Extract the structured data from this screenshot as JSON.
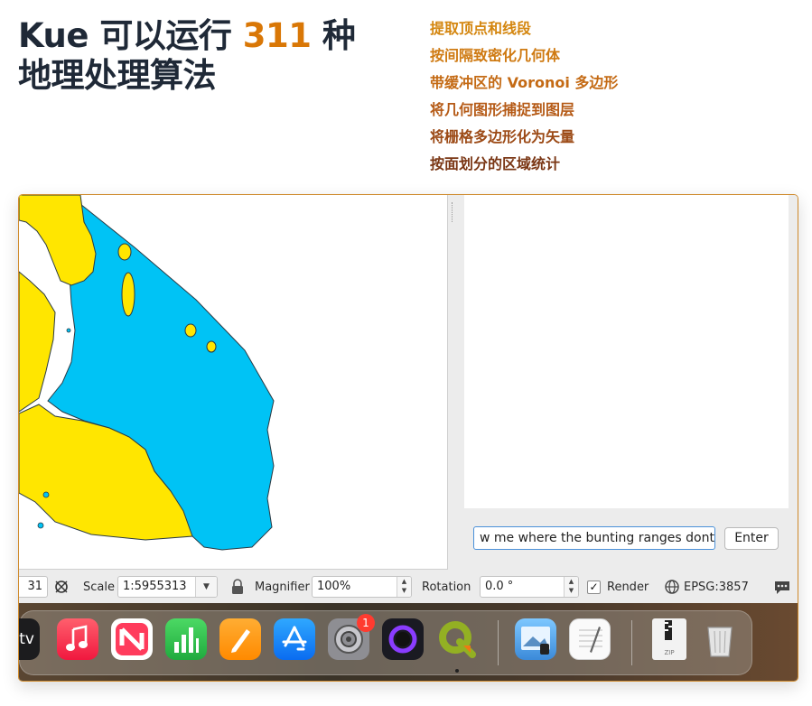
{
  "headline": {
    "line1_prefix": "Kue 可以运行",
    "line1_number": "311",
    "line1_suffix": "种",
    "line2": "地理处理算法",
    "accent_color": "#d97706"
  },
  "features": [
    {
      "text": "提取顶点和线段",
      "color": "#d4860f"
    },
    {
      "text": "按间隔致密化几何体",
      "color": "#cf7a12"
    },
    {
      "text": "带缓冲区的 Voronoi 多边形",
      "color": "#c46a14"
    },
    {
      "text": "将几何图形捕捉到图层",
      "color": "#b55a16"
    },
    {
      "text": "将栅格多边形化为矢量",
      "color": "#9c4a16"
    },
    {
      "text": "按面划分的区域统计",
      "color": "#7a3614"
    }
  ],
  "chat": {
    "input_value": "w me where the bunting ranges dont",
    "enter_label": "Enter"
  },
  "statusbar": {
    "coordinate_partial": "31",
    "scale_label": "Scale",
    "scale_value": "1:5955313",
    "magnifier_label": "Magnifier",
    "magnifier_value": "100%",
    "rotation_label": "Rotation",
    "rotation_value": "0.0 °",
    "render_label": "Render",
    "render_checked": true,
    "crs_value": "EPSG:3857"
  },
  "dock": {
    "partial_app_label": "tv",
    "apps": [
      {
        "name": "Music",
        "icon": "music-icon"
      },
      {
        "name": "News",
        "icon": "news-icon"
      },
      {
        "name": "Numbers",
        "icon": "numbers-icon"
      },
      {
        "name": "Pages",
        "icon": "pages-icon"
      },
      {
        "name": "App Store",
        "icon": "app-store-icon"
      },
      {
        "name": "System Preferences",
        "icon": "system-preferences-icon",
        "badge": "1"
      },
      {
        "name": "Screen Recorder",
        "icon": "screen-recorder-icon"
      },
      {
        "name": "QGIS",
        "icon": "qgis-icon",
        "running": true
      },
      {
        "name": "Preview",
        "icon": "preview-icon"
      },
      {
        "name": "TextEdit",
        "icon": "textedit-icon"
      },
      {
        "name": "Archive",
        "icon": "zip-file-icon",
        "label": "ZIP"
      },
      {
        "name": "Trash",
        "icon": "trash-icon"
      }
    ]
  },
  "map": {
    "land_color": "#ffe600",
    "water_region_color": "#00c3f5",
    "outline_color": "#2a3a44"
  }
}
